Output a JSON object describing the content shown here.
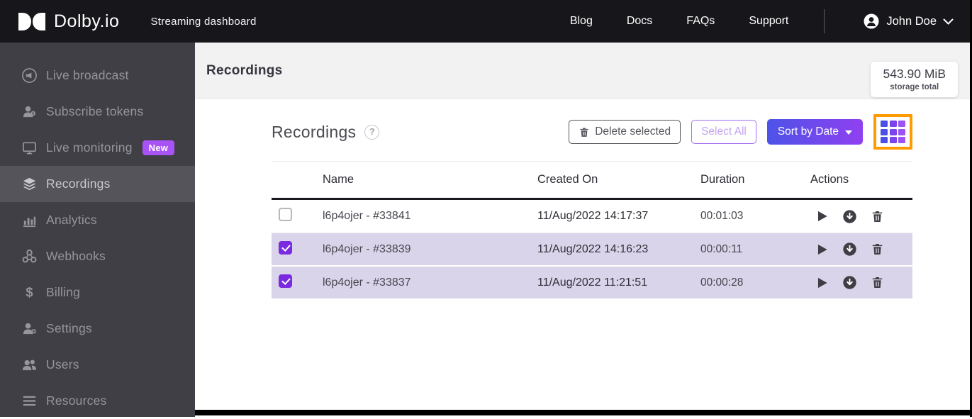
{
  "header": {
    "brand": "Dolby.io",
    "subtitle": "Streaming dashboard",
    "nav": [
      "Blog",
      "Docs",
      "FAQs",
      "Support"
    ],
    "user": "John Doe"
  },
  "sidebar": {
    "items": [
      {
        "label": "Live broadcast",
        "icon": "broadcast-icon",
        "active": false
      },
      {
        "label": "Subscribe tokens",
        "icon": "subscribe-tokens-icon",
        "active": false
      },
      {
        "label": "Live monitoring",
        "icon": "monitor-icon",
        "badge": "New",
        "active": false
      },
      {
        "label": "Recordings",
        "icon": "layers-icon",
        "active": true
      },
      {
        "label": "Analytics",
        "icon": "analytics-icon",
        "active": false
      },
      {
        "label": "Webhooks",
        "icon": "webhooks-icon",
        "active": false
      },
      {
        "label": "Billing",
        "icon": "billing-icon",
        "active": false
      },
      {
        "label": "Settings",
        "icon": "settings-icon",
        "active": false
      },
      {
        "label": "Users",
        "icon": "users-icon",
        "active": false
      },
      {
        "label": "Resources",
        "icon": "resources-icon",
        "active": false
      }
    ]
  },
  "page": {
    "title": "Recordings",
    "storage": {
      "value": "543.90 MiB",
      "label": "storage total"
    }
  },
  "toolbar": {
    "section_title": "Recordings",
    "help_glyph": "?",
    "delete_selected": "Delete selected",
    "select_all": "Select All",
    "sort_by": "Sort by Date"
  },
  "table": {
    "columns": [
      "Name",
      "Created On",
      "Duration",
      "Actions"
    ],
    "rows": [
      {
        "checked": false,
        "name": "l6p4ojer - #33841",
        "created": "11/Aug/2022 14:17:37",
        "duration": "00:01:03"
      },
      {
        "checked": true,
        "name": "l6p4ojer - #33839",
        "created": "11/Aug/2022 14:16:23",
        "duration": "00:00:11"
      },
      {
        "checked": true,
        "name": "l6p4ojer - #33837",
        "created": "11/Aug/2022 11:21:51",
        "duration": "00:00:28"
      }
    ]
  },
  "colors": {
    "accent_purple": "#8a3ff0",
    "sort_gradient_start": "#4d53e8",
    "sort_gradient_end": "#9040f0",
    "selected_row_bg": "#dad4ea",
    "checkbox_checked": "#7a2be0",
    "highlight_orange": "#ff9b00",
    "new_badge": "#a853f6",
    "sidebar_bg": "#403f45",
    "header_bg": "#17171b"
  }
}
